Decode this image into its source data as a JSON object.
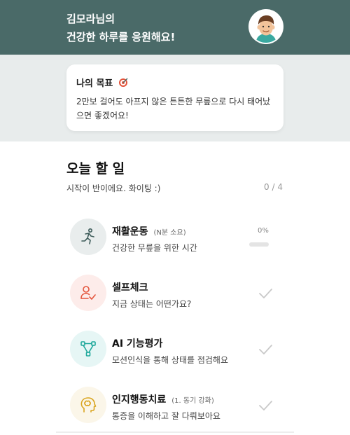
{
  "header": {
    "greeting_line1": "김모라님의",
    "greeting_line2": "건강한 하루를 응원해요!",
    "bg_color": "#4a6a68"
  },
  "goal": {
    "title": "나의 목표",
    "icon": "dart-target-icon",
    "text": "2만보 걸어도 아프지 않은 튼튼한 무릎으로 다시 태어났으면 좋겠어요!"
  },
  "today": {
    "title": "오늘 할 일",
    "subtitle": "시작이 반이에요. 화이팅 :)",
    "count": "0 / 4"
  },
  "tasks": [
    {
      "title": "재활운동",
      "tag": "(N분 소요)",
      "desc": "건강한 무릎을 위한 시간",
      "icon": "running-person-icon",
      "icon_bg": "#e9eded",
      "progress_label": "0%",
      "progress": 0
    },
    {
      "title": "셀프체크",
      "tag": "",
      "desc": "지금 상태는 어떤가요?",
      "icon": "user-check-icon",
      "icon_bg": "#fdecea",
      "status": "check-icon"
    },
    {
      "title": "AI 기능평가",
      "tag": "",
      "desc": "모션인식을 통해 상태를 점검해요",
      "icon": "node-graph-icon",
      "icon_bg": "#e6f6f5",
      "status": "check-icon"
    },
    {
      "title": "인지행동치료",
      "tag": "(1. 동기 강화)",
      "desc": "통증을 이해하고 잘 다뤄보아요",
      "icon": "brain-head-icon",
      "icon_bg": "#fbf6e9",
      "status": "check-icon"
    }
  ]
}
